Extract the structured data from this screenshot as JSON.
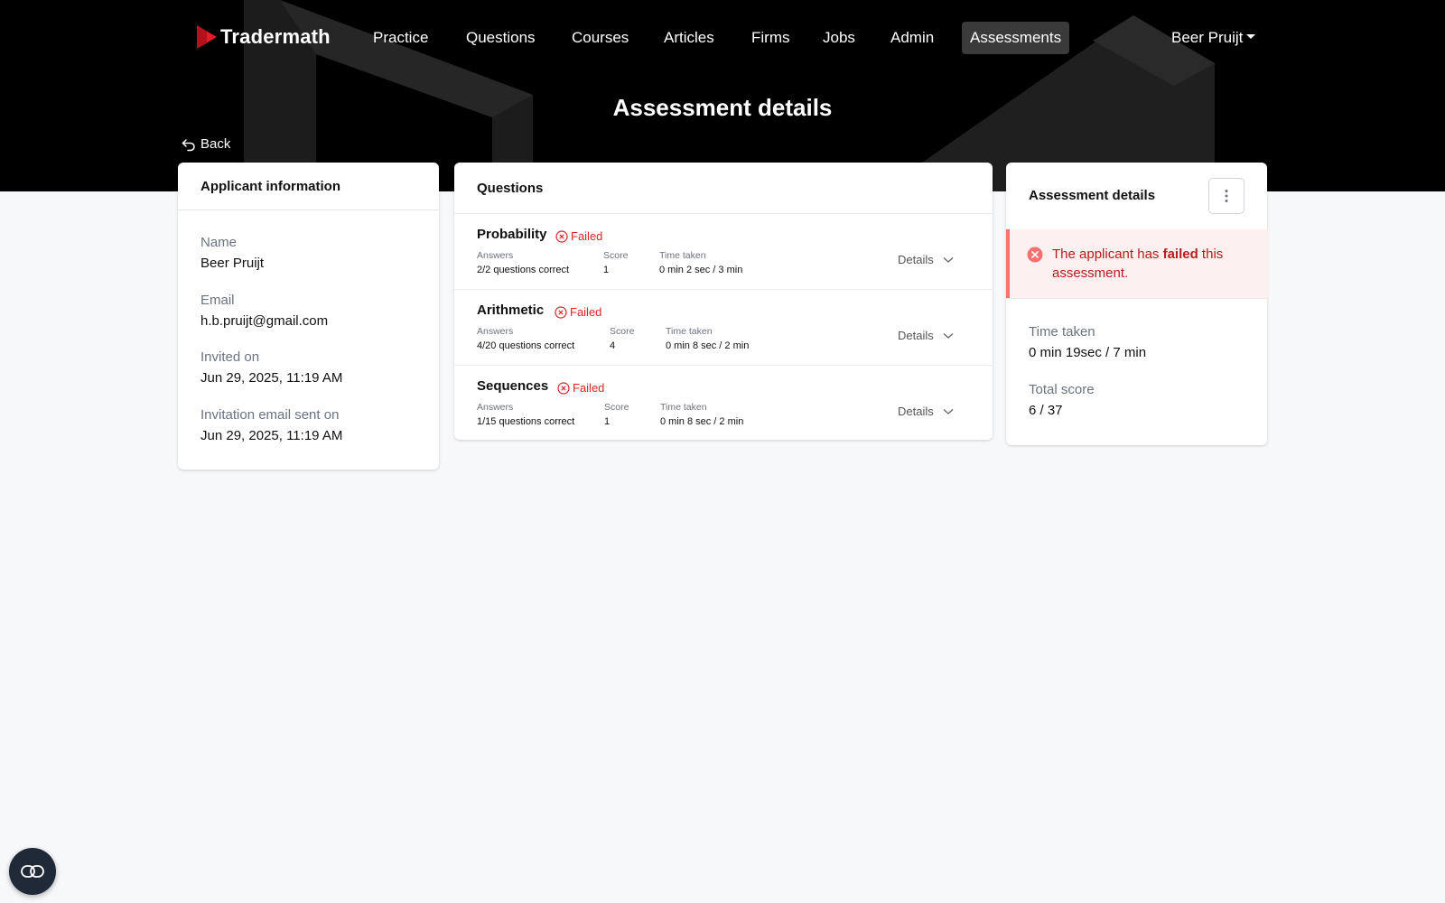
{
  "brand": {
    "name": "Tradermath",
    "accent": "#e11d2a"
  },
  "nav": {
    "items": [
      {
        "label": "Practice"
      },
      {
        "label": "Questions"
      },
      {
        "label": "Courses"
      },
      {
        "label": "Articles"
      },
      {
        "label": "Firms"
      },
      {
        "label": "Jobs"
      },
      {
        "label": "Admin"
      },
      {
        "label": "Assessments",
        "active": true
      }
    ],
    "user": "Beer Pruijt"
  },
  "page": {
    "title": "Assessment details",
    "back_label": "Back"
  },
  "applicant": {
    "header": "Applicant information",
    "fields": [
      {
        "label": "Name",
        "value": "Beer Pruijt"
      },
      {
        "label": "Email",
        "value": "h.b.pruijt@gmail.com"
      },
      {
        "label": "Invited on",
        "value": "Jun 29, 2025, 11:19 AM"
      },
      {
        "label": "Invitation email sent on",
        "value": "Jun 29, 2025, 11:19 AM"
      }
    ]
  },
  "questions": {
    "header": "Questions",
    "answers_label": "Answers",
    "score_label": "Score",
    "time_label": "Time taken",
    "details_label": "Details",
    "items": [
      {
        "title": "Probability",
        "status": "Failed",
        "answers": "2/2 questions correct",
        "score": "1",
        "time": "0 min 2 sec / 3 min"
      },
      {
        "title": "Arithmetic",
        "status": "Failed",
        "answers": "4/20 questions correct",
        "score": "4",
        "time": "0 min 8 sec / 2 min"
      },
      {
        "title": "Sequences",
        "status": "Failed",
        "answers": "1/15 questions correct",
        "score": "1",
        "time": "0 min 8 sec / 2 min"
      }
    ]
  },
  "summary": {
    "header": "Assessment details",
    "alert_prefix": "The applicant has ",
    "alert_bold": "failed",
    "alert_suffix": " this assessment.",
    "time_label": "Time taken",
    "time_value": "0 min 19sec / 7 min",
    "score_label": "Total score",
    "score_value": "6 / 37"
  },
  "colors": {
    "failed": "#dc2626",
    "alert_bg": "#fdf0f0",
    "alert_border": "#f87171"
  }
}
